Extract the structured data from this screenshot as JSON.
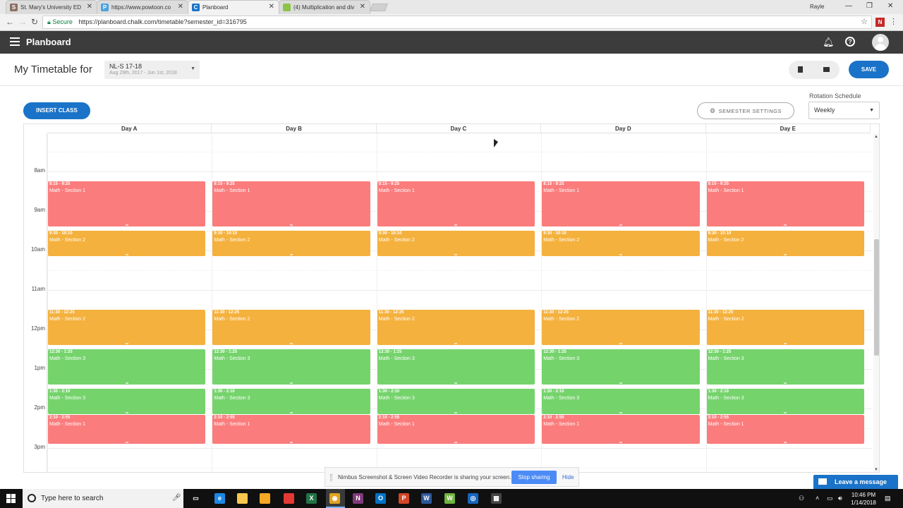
{
  "browser": {
    "tabs": [
      {
        "title": "St. Mary's University ED",
        "fav_color": "#8d6e63",
        "fav": "S"
      },
      {
        "title": "https://www.powtoon.co",
        "fav_color": "#4aa3df",
        "fav": "P"
      },
      {
        "title": "Planboard",
        "fav_color": "#1a73c8",
        "fav": "C"
      },
      {
        "title": "(4) Multiplication and div",
        "fav_color": "#8bc34a",
        "fav": ""
      }
    ],
    "profile": "Rayle",
    "secure_label": "Secure",
    "url": "https://planboard.chalk.com/timetable?semester_id=316795",
    "ext_label": "N"
  },
  "app": {
    "brand": "Planboard",
    "page_title": "My Timetable for",
    "semester": {
      "name": "NL-S 17-18",
      "dates": "Aug 29th, 2017 - Jun 1st, 2018"
    },
    "save_label": "SAVE",
    "insert_label": "INSERT CLASS",
    "settings_label": "SEMESTER SETTINGS",
    "rotation_label": "Rotation Schedule",
    "rotation_value": "Weekly"
  },
  "calendar": {
    "days": [
      "Day A",
      "Day B",
      "Day C",
      "Day D",
      "Day E"
    ],
    "times": [
      "8am",
      "9am",
      "10am",
      "11am",
      "12pm",
      "1pm",
      "2pm",
      "3pm"
    ],
    "colors": {
      "red": "#fb7c7c",
      "orange": "#f4b13d",
      "green": "#75d36c"
    },
    "blocks": [
      {
        "time": "8:15 - 9:25",
        "name": "Math - Section 1",
        "color": "red",
        "start": 8.25,
        "end": 9.4167
      },
      {
        "time": "9:30 - 10:10",
        "name": "Math - Section 2",
        "color": "orange",
        "start": 9.5,
        "end": 10.1667
      },
      {
        "time": "11:30 - 12:25",
        "name": "Math - Section 2",
        "color": "orange",
        "start": 11.5,
        "end": 12.4167
      },
      {
        "time": "12:30 - 1:25",
        "name": "Math - Section 3",
        "color": "green",
        "start": 12.5,
        "end": 13.4167
      },
      {
        "time": "1:30 - 2:10",
        "name": "Math - Section 3",
        "color": "green",
        "start": 13.5,
        "end": 14.1667
      },
      {
        "time": "2:10 - 2:55",
        "name": "Math - Section 1",
        "color": "red",
        "start": 14.1667,
        "end": 14.9167
      }
    ]
  },
  "share": {
    "message": "Nimbus Screenshot & Screen Video Recorder is sharing your screen.",
    "stop_label": "Stop sharing",
    "hide_label": "Hide"
  },
  "chat": {
    "label": "Leave a message"
  },
  "taskbar": {
    "search_placeholder": "Type here to search",
    "time": "10:46 PM",
    "date": "1/14/2018",
    "apps": [
      {
        "name": "task-view-icon",
        "color": "#101010",
        "glyph": "▭"
      },
      {
        "name": "edge-icon",
        "color": "#1e88e5",
        "glyph": "e"
      },
      {
        "name": "file-explorer-icon",
        "color": "#f9c74f",
        "glyph": ""
      },
      {
        "name": "store-icon",
        "color": "#f9a825",
        "glyph": ""
      },
      {
        "name": "app-red-icon",
        "color": "#e53935",
        "glyph": ""
      },
      {
        "name": "excel-icon",
        "color": "#217346",
        "glyph": "X"
      },
      {
        "name": "chrome-icon",
        "color": "#e0a422",
        "glyph": "◉"
      },
      {
        "name": "onenote-icon",
        "color": "#80397b",
        "glyph": "N"
      },
      {
        "name": "outlook-icon",
        "color": "#0072c6",
        "glyph": "O"
      },
      {
        "name": "powerpoint-icon",
        "color": "#d24726",
        "glyph": "P"
      },
      {
        "name": "word-icon",
        "color": "#2b579a",
        "glyph": "W"
      },
      {
        "name": "app-green-icon",
        "color": "#6fb43f",
        "glyph": "W"
      },
      {
        "name": "app-blue-icon",
        "color": "#1565c0",
        "glyph": "◎"
      },
      {
        "name": "calculator-icon",
        "color": "#444",
        "glyph": "▦"
      }
    ]
  }
}
